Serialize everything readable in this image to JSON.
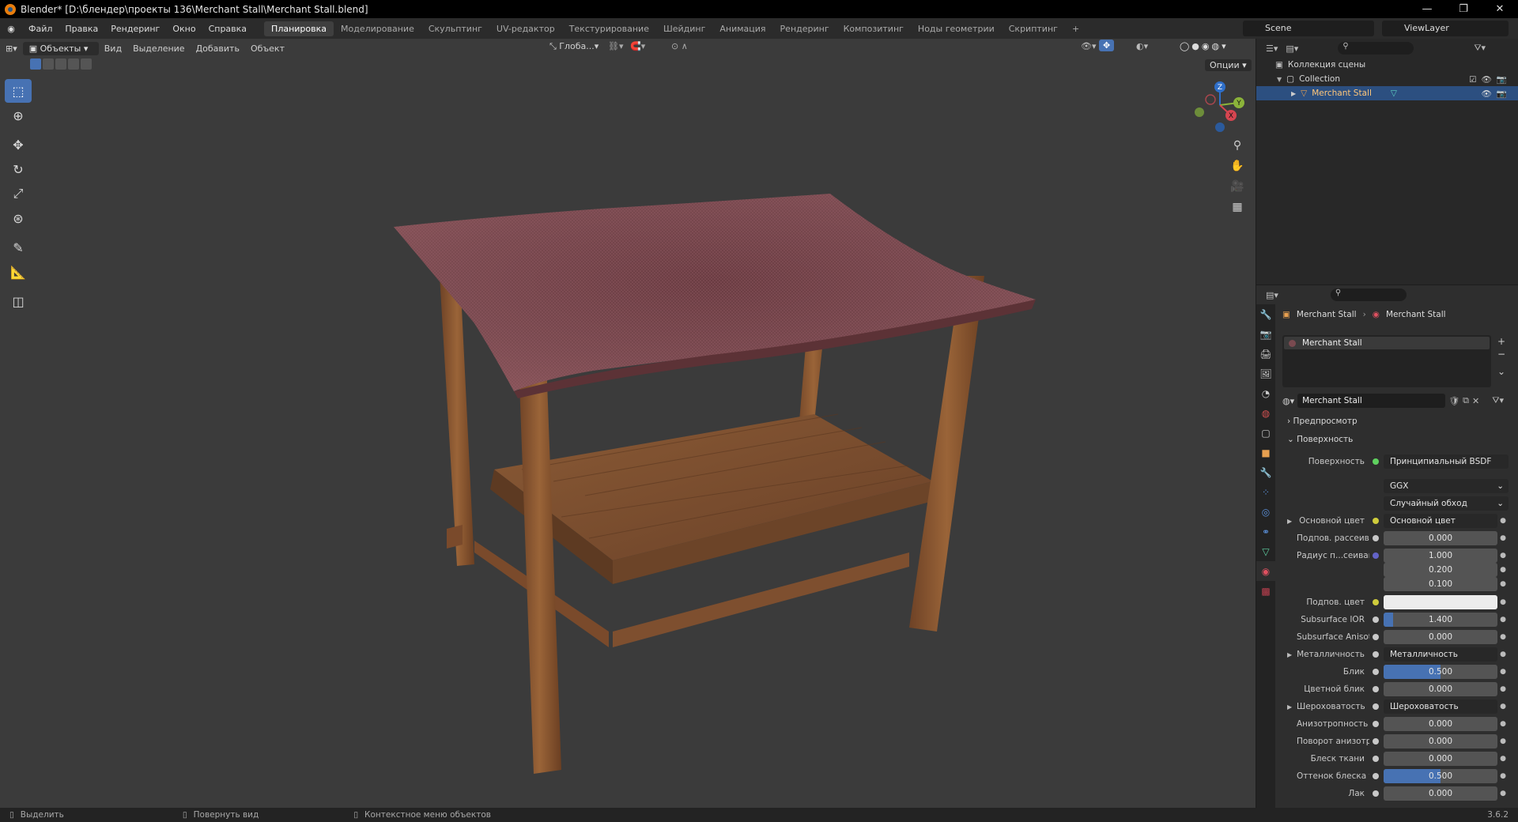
{
  "window": {
    "title": "Blender* [D:\\блендер\\проекты 136\\Merchant Stall\\Merchant Stall.blend]",
    "min": "—",
    "max": "❐",
    "close": "✕"
  },
  "menu": [
    "Файл",
    "Правка",
    "Рендеринг",
    "Окно",
    "Справка"
  ],
  "workspaces": [
    "Планировка",
    "Моделирование",
    "Скульптинг",
    "UV-редактор",
    "Текстурирование",
    "Шейдинг",
    "Анимация",
    "Рендеринг",
    "Композитинг",
    "Ноды геометрии",
    "Скриптинг"
  ],
  "add_tab": "+",
  "scene": "Scene",
  "view_layer": "ViewLayer",
  "viewport": {
    "mode": "Объекты",
    "menus": [
      "Вид",
      "Выделение",
      "Добавить",
      "Объект"
    ],
    "orientation": "Глоба...",
    "options": "Опции",
    "gizmo": {
      "x": "X",
      "y": "Y",
      "z": "Z"
    }
  },
  "outliner": {
    "root": "Коллекция сцены",
    "collection": "Collection",
    "object": "Merchant Stall"
  },
  "properties": {
    "breadcrumb_obj": "Merchant Stall",
    "breadcrumb_mat": "Merchant Stall",
    "slot": "Merchant Stall",
    "material_name": "Merchant Stall",
    "panel_preview": "Предпросмотр",
    "panel_surface": "Поверхность",
    "surface_label": "Поверхность",
    "surface_value": "Принципиальный BSDF",
    "distribution": "GGX",
    "subsurface_method": "Случайный обход",
    "rows": [
      {
        "label": "Основной цвет",
        "value": "Основной цвет",
        "kind": "link",
        "dot": "y",
        "arrow": true
      },
      {
        "label": "Подпов. рассеива...",
        "value": "0.000",
        "kind": "num",
        "dot": "g"
      },
      {
        "label": "Радиус п...сеивания",
        "value": "1.000",
        "kind": "num",
        "dot": "b"
      },
      {
        "label": "",
        "value": "0.200",
        "kind": "num",
        "dot": ""
      },
      {
        "label": "",
        "value": "0.100",
        "kind": "num",
        "dot": ""
      },
      {
        "label": "Подпов. цвет",
        "value": "",
        "kind": "color",
        "dot": "y"
      },
      {
        "label": "Subsurface IOR",
        "value": "1.400",
        "kind": "num",
        "dot": "g",
        "fill": 0.08
      },
      {
        "label": "Subsurface Anisotr...",
        "value": "0.000",
        "kind": "num",
        "dot": "g"
      },
      {
        "label": "Металличность",
        "value": "Металличность",
        "kind": "link",
        "dot": "g",
        "arrow": true
      },
      {
        "label": "Блик",
        "value": "0.500",
        "kind": "num",
        "dot": "g",
        "fill": 0.5
      },
      {
        "label": "Цветной блик",
        "value": "0.000",
        "kind": "num",
        "dot": "g"
      },
      {
        "label": "Шероховатость",
        "value": "Шероховатость",
        "kind": "link",
        "dot": "g",
        "arrow": true
      },
      {
        "label": "Анизотропность",
        "value": "0.000",
        "kind": "num",
        "dot": "g"
      },
      {
        "label": "Поворот анизотро...",
        "value": "0.000",
        "kind": "num",
        "dot": "g"
      },
      {
        "label": "Блеск ткани",
        "value": "0.000",
        "kind": "num",
        "dot": "g"
      },
      {
        "label": "Оттенок блеска тк...",
        "value": "0.500",
        "kind": "num",
        "dot": "g",
        "fill": 0.5
      },
      {
        "label": "Лак",
        "value": "0.000",
        "kind": "num",
        "dot": "g"
      }
    ]
  },
  "status": {
    "select": "Выделить",
    "rotate": "Повернуть вид",
    "context": "Контекстное меню объектов",
    "version": "3.6.2"
  }
}
